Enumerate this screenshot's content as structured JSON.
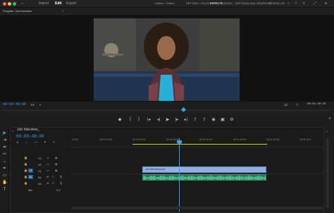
{
  "titlebar": {
    "nav": [
      "Home",
      "Import",
      "Edit",
      "Export"
    ],
    "active_nav": "Edit",
    "doc_title": "Untitled - Edited",
    "workspaces": [
      "SETTING",
      "COLOR",
      "EFFECTS",
      "AUDIO",
      "CAPTIONS AND GRAPHICS",
      "REVIEW",
      "LIB"
    ],
    "active_workspace": "EFFECTS"
  },
  "program_monitor": {
    "tab": "Program: Job Interview",
    "timecode_left": "00:00:48:00",
    "fit": "Fit",
    "quality": "1/2",
    "timecode_right": "00:01:26:19"
  },
  "transport": {
    "buttons": [
      "mark-in",
      "mark-out",
      "mark-clip",
      "go-to-in",
      "step-back",
      "play",
      "step-forward",
      "go-to-out",
      "lift",
      "extract",
      "export-frame",
      "comparison",
      "settings"
    ]
  },
  "timeline": {
    "tab": "Job Interview",
    "timecode": "00:00:48:00",
    "ruler_ticks": [
      "00:00",
      "00:00:15:00",
      "00:00:30:00",
      "00:00:45:00",
      "00:01:00:00",
      "00:01:15:00",
      "00:01:30:00",
      "00:01:45:0"
    ],
    "tracks": [
      {
        "name": "V3",
        "target": "V3"
      },
      {
        "name": "V2",
        "target": "V2"
      },
      {
        "name": "V1",
        "target": "V1"
      },
      {
        "name": "A1",
        "target": "A1"
      },
      {
        "name": "A2",
        "target": "A2"
      },
      {
        "name": "Mix",
        "value": "0.0"
      }
    ],
    "video_clip": "Job Interview.mp4",
    "playhead_seconds": 48
  },
  "colors": {
    "accent": "#3aa0e8",
    "video_clip": "#8fb0e0",
    "audio_clip": "#1c7a55",
    "workbar": "#d4c93c"
  }
}
